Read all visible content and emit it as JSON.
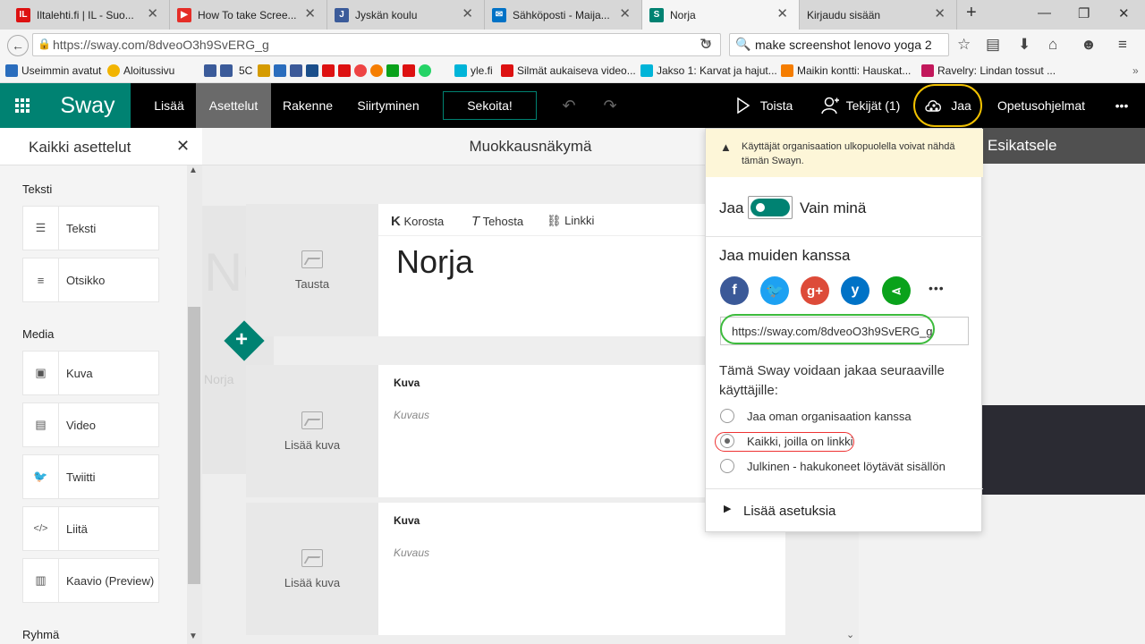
{
  "browser": {
    "tabs": [
      {
        "title": "Iltalehti.fi | IL - Suo...",
        "active": false,
        "favicon_color": "#d11"
      },
      {
        "title": "How To take Scree...",
        "active": false,
        "favicon_color": "#e52d27"
      },
      {
        "title": "Jyskän koulu",
        "active": false,
        "favicon_color": "#3b5b9a"
      },
      {
        "title": "Sähköposti - Maija...",
        "active": false,
        "favicon_color": "#0072c6"
      },
      {
        "title": "Norja",
        "active": true,
        "favicon_color": "#008272"
      },
      {
        "title": "Kirjaudu sisään",
        "active": false,
        "favicon_color": ""
      }
    ],
    "url": "https://sway.com/8dveoO3h9SvERG_g",
    "search": "make screenshot lenovo yoga 2",
    "bookmarks": [
      {
        "label": "Useimmin avatut",
        "color": "#2a6dbd"
      },
      {
        "label": "Aloitussivu",
        "color": "#f2b400"
      },
      {
        "label": "5C",
        "color": "#3b5b9a"
      },
      {
        "label": "yle.fi",
        "color": "#00b4d8"
      },
      {
        "label": "Silmät aukaiseva video...",
        "color": "#d11"
      },
      {
        "label": "Jakso 1: Karvat ja hajut...",
        "color": "#00b4d8"
      },
      {
        "label": "Maikin kontti: Hauskat...",
        "color": "#f57d00"
      },
      {
        "label": "Ravelry: Lindan tossut ...",
        "color": "#c2185b"
      }
    ]
  },
  "sway": {
    "logo": "Sway",
    "menu": [
      "Lisää",
      "Asettelut",
      "Rakenne",
      "Siirtyminen"
    ],
    "shuffle": "Sekoita!",
    "play": "Toista",
    "authors": "Tekijät (1)",
    "share": "Jaa",
    "tutorials": "Opetusohjelmat",
    "more": "•••"
  },
  "left_panel": {
    "title": "Kaikki asettelut",
    "sections": [
      {
        "heading": "Teksti",
        "items": [
          {
            "label": "Teksti",
            "icon": "text-lines-icon"
          },
          {
            "label": "Otsikko",
            "icon": "heading-icon"
          }
        ]
      },
      {
        "heading": "Media",
        "items": [
          {
            "label": "Kuva",
            "icon": "image-icon"
          },
          {
            "label": "Video",
            "icon": "video-icon"
          },
          {
            "label": "Twiitti",
            "icon": "twitter-icon"
          },
          {
            "label": "Liitä",
            "icon": "embed-icon"
          },
          {
            "label": "Kaavio (Preview)",
            "icon": "chart-icon"
          }
        ]
      },
      {
        "heading": "Ryhmä",
        "items": []
      }
    ]
  },
  "editor": {
    "title": "Muokkausnäkymä",
    "bg_title_ghost": "NO",
    "bg_sub_ghost": "Norja",
    "title_card": {
      "background_label": "Tausta",
      "toolbar": [
        "Korosta",
        "Tehosta",
        "Linkki"
      ],
      "heading": "Norja"
    },
    "image_cards": [
      {
        "add_label": "Lisää kuva",
        "type_label": "Kuva",
        "caption_placeholder": "Kuvaus"
      },
      {
        "add_label": "Lisää kuva",
        "type_label": "Kuva",
        "caption_placeholder": "Kuvaus"
      }
    ]
  },
  "preview": {
    "title": "Esikatsele"
  },
  "share_panel": {
    "warning": "Käyttäjät organisaation ulkopuolella voivat nähdä tämän Swayn.",
    "toggle_left": "Jaa",
    "toggle_right": "Vain minä",
    "share_with_others": "Jaa muiden kanssa",
    "social": [
      {
        "name": "facebook",
        "glyph": "f",
        "color": "#3b5998"
      },
      {
        "name": "twitter",
        "glyph": "t",
        "color": "#1da1f2"
      },
      {
        "name": "google-plus",
        "glyph": "g+",
        "color": "#dd4b39"
      },
      {
        "name": "yammer",
        "glyph": "y",
        "color": "#0072c6"
      },
      {
        "name": "share",
        "glyph": "<",
        "color": "#0aa21b"
      }
    ],
    "more": "•••",
    "link": "https://sway.com/8dveoO3h9SvERG_g",
    "scope_text": "Tämä Sway voidaan jakaa seuraaville käyttäjille:",
    "options": [
      {
        "label": "Jaa oman organisaation kanssa",
        "selected": false
      },
      {
        "label": "Kaikki, joilla on linkki",
        "selected": true
      },
      {
        "label": "Julkinen - hakukoneet löytävät sisällön",
        "selected": false
      }
    ],
    "more_settings": "Lisää asetuksia"
  },
  "colors": {
    "sway_green": "#008272",
    "highlight_yellow": "#f2c200",
    "highlight_green": "#3dbb3d",
    "highlight_red": "#e33"
  }
}
